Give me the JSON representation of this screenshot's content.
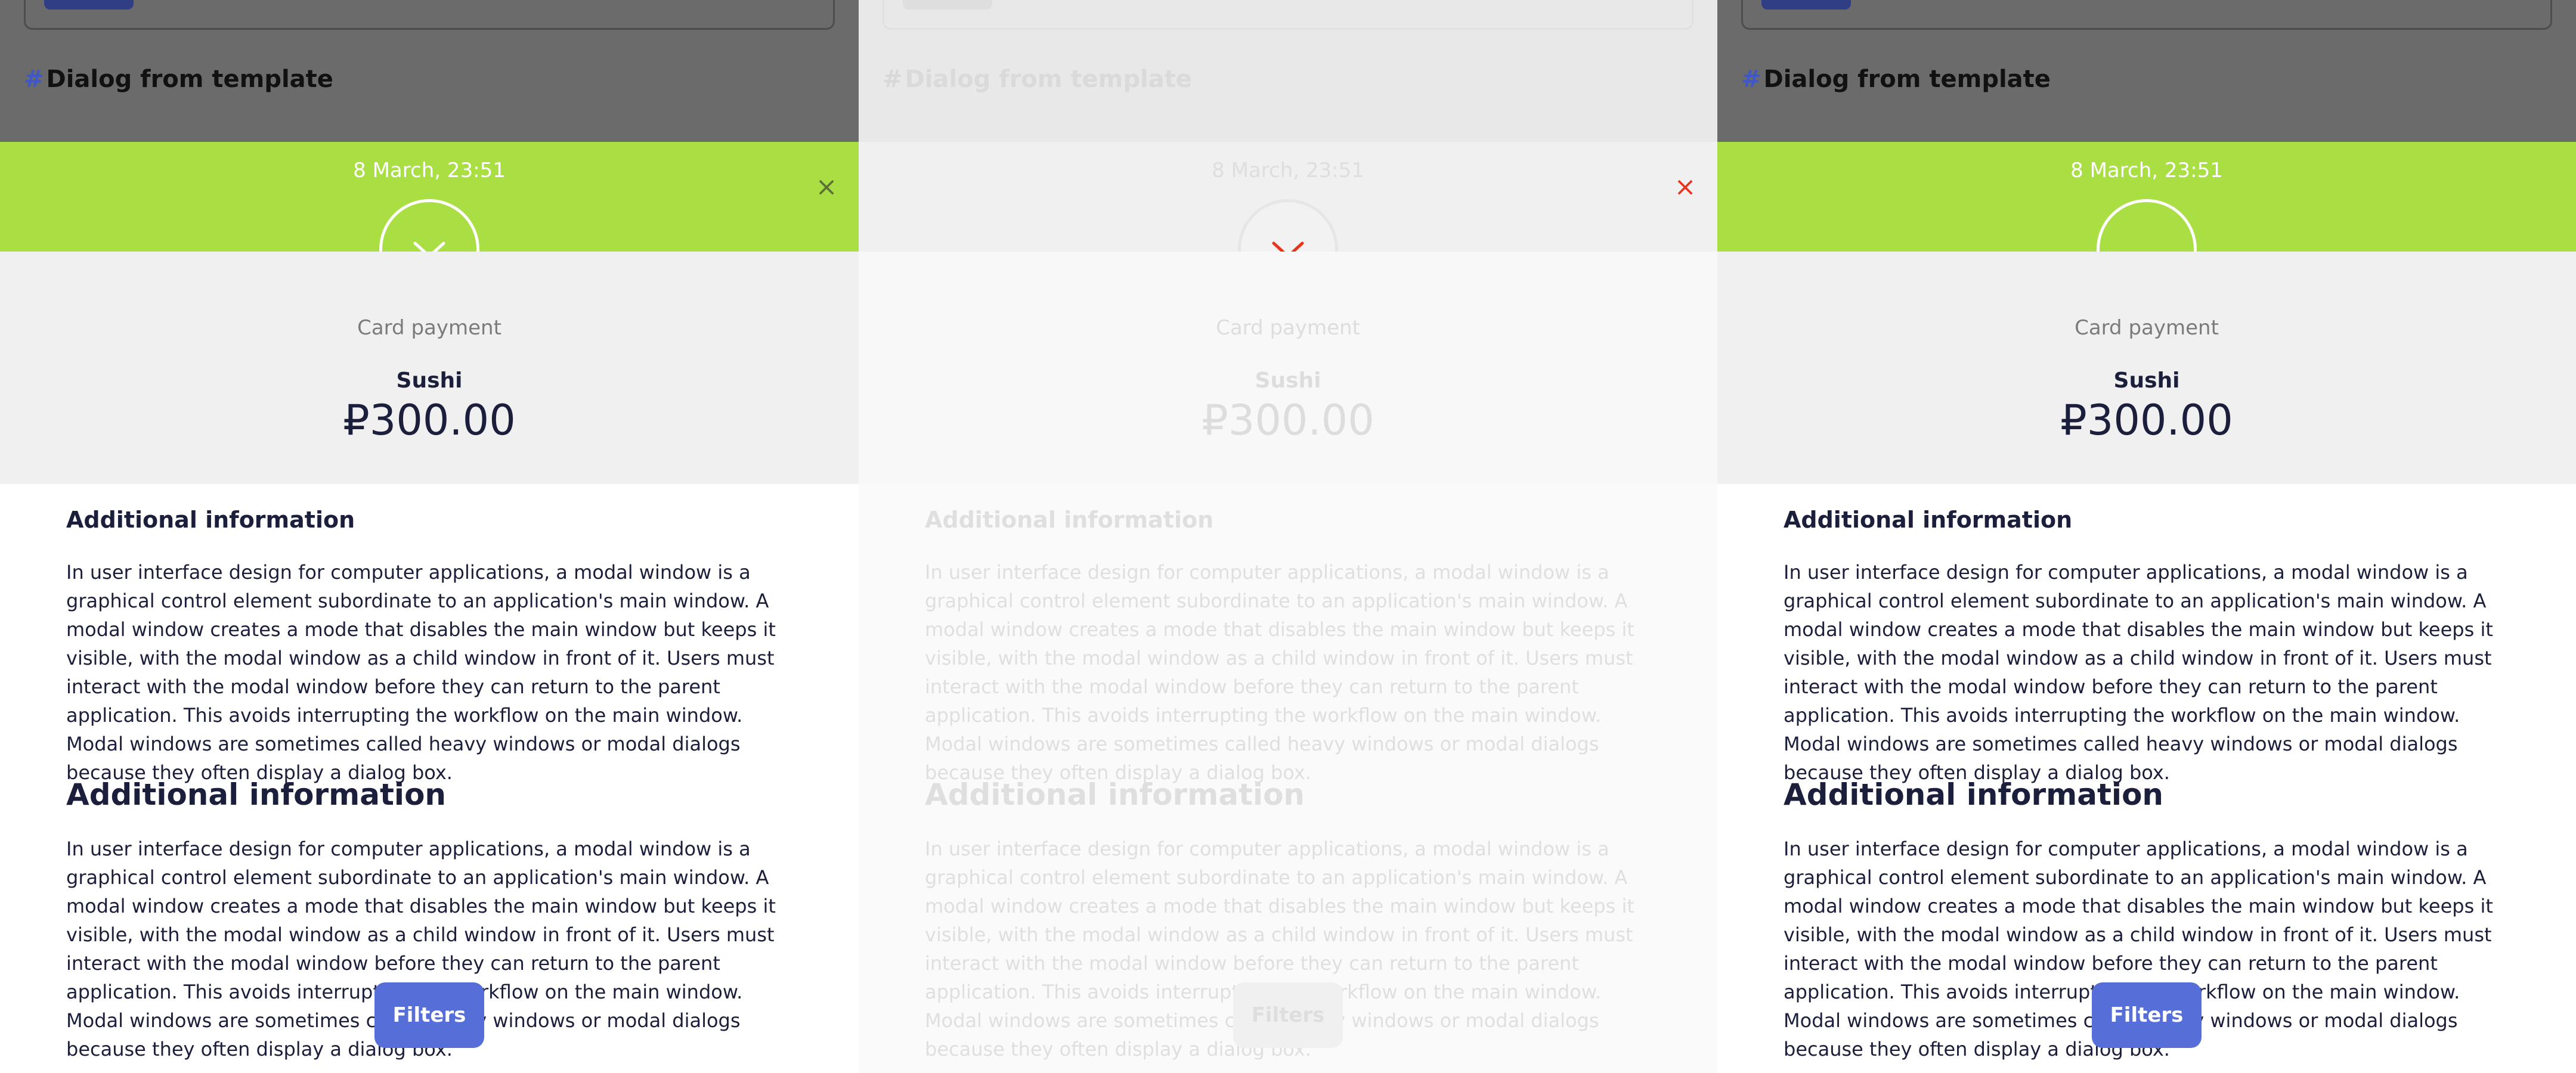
{
  "section": {
    "hash": "#",
    "title": "Dialog from template"
  },
  "dialog": {
    "date": "8 March, 23:51",
    "close_glyph": "×",
    "payment_method": "Card payment",
    "item_title": "Sushi",
    "amount": "₽300.00",
    "heading_small": "Additional information",
    "heading_large": "Additional information",
    "paragraph_1": "In user interface design for computer applications, a modal window is a graphical control element subordinate to an application's main window. A modal window creates a mode that disables the main window but keeps it visible, with the modal window as a child window in front of it. Users must interact with the modal window before they can return to the parent application. This avoids interrupting the workflow on the main window. Modal windows are sometimes called heavy windows or modal dialogs because they often display a dialog box.",
    "paragraph_2": "In user interface design for computer applications, a modal window is a graphical control element subordinate to an application's main window. A modal window creates a mode that disables the main window but keeps it visible, with the modal window as a child window in front of it. Users must interact with the modal window before they can return to the parent application. This avoids interrupting the workflow on the main window. Modal windows are sometimes called heavy windows or modal dialogs because they often display a dialog box.",
    "filters_label": "Filters"
  },
  "colors": {
    "accent_green": "#a9df43",
    "primary_blue": "#566ed8",
    "close_red": "#e8341b"
  },
  "icons": {
    "status": "chevron-down-icon",
    "close": "close-icon"
  }
}
